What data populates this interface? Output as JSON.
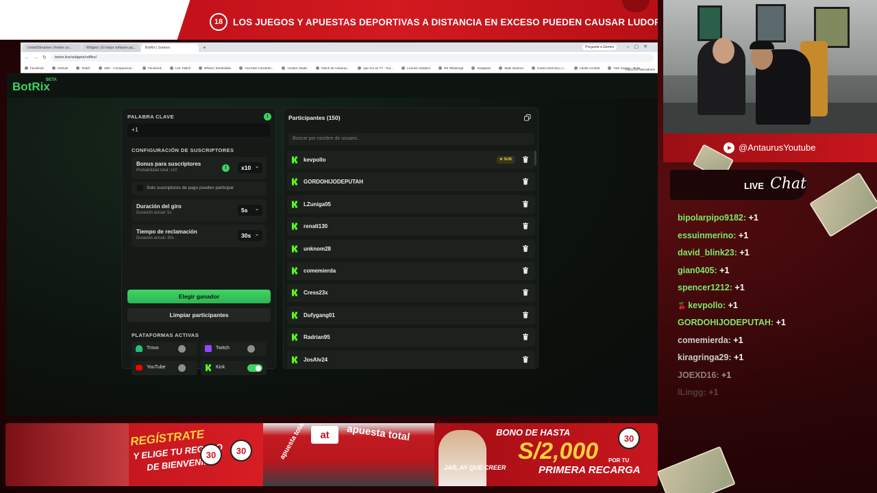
{
  "top_banner": {
    "age_badge": "18",
    "warning": "LOS JUEGOS Y APUESTAS DEPORTIVAS A DISTANCIA EN EXCESO PUEDEN CAUSAR LUDOPATÍA."
  },
  "browser": {
    "tabs": [
      "UnitedStreamer | Retenr yo...",
      "Widgets | El mejor software pa...",
      "BotRix | Sorteos"
    ],
    "new_tab": "+",
    "gemini": "Pregunta a Gemini",
    "url": "botrix.live/widgets/raffles/",
    "bookmarks": [
      "Facebook",
      "Hotmail",
      "Twitch",
      "UNC - Comparacion...",
      "Facebook",
      "LOL Twitch",
      "Wheel | Streamlabs",
      "YouTube Converter...",
      "Creator Studio",
      "Twitch de Antaurus...",
      "que rico es TT - You...",
      "License Violation",
      "DE WhatsApp",
      "Instagram",
      "Male Vazarna",
      "Casino Directory | t...",
      "Adobe Acrobat",
      "Twin Casino - Onlin..."
    ],
    "bookmarks_right": "Todos los marcadores"
  },
  "app": {
    "logo": "BotRix",
    "beta": "BETA",
    "keyword_label": "PALABRA CLAVE",
    "keyword_value": "+1",
    "subs_config_label": "CONFIGURACIÓN DE SUSCRIPTORES",
    "bonus_title": "Bonus para suscriptores",
    "bonus_sub": "Probabilidad total: x10",
    "bonus_value": "x10",
    "paid_only": "Solo suscriptores de pago pueden participar",
    "spin_title": "Duración del giro",
    "spin_sub": "Duración actual: 5s",
    "spin_value": "5s",
    "claim_title": "Tiempo de reclamación",
    "claim_sub": "Duración actual: 30s",
    "claim_value": "30s",
    "choose_winner": "Elegir ganador",
    "clear_participants": "Limpiar participantes",
    "platforms_label": "PLATAFORMAS ACTIVAS",
    "platforms": [
      {
        "name": "Trovo",
        "on": false,
        "color": "#1fc37a"
      },
      {
        "name": "Twitch",
        "on": false,
        "color": "#9146ff"
      },
      {
        "name": "YouTube",
        "on": false,
        "color": "#ff0000"
      },
      {
        "name": "Kick",
        "on": true,
        "color": "#53fc18"
      }
    ],
    "participants_title": "Participantes (150)",
    "search_placeholder": "Buscar por nombre de usuario...",
    "sub_badge": "SUB",
    "participants": [
      "kevpollo",
      "GORDOHIJODEPUTAH",
      "LZuniga05",
      "renalt130",
      "unknom28",
      "comemierda",
      "Cress23x",
      "Dufygang01",
      "Radrian95",
      "JosAlv24"
    ]
  },
  "stream": {
    "yt_handle": "@AntaurusYoutube",
    "live": "LIVE",
    "chat_word": "Chat",
    "messages": [
      {
        "user": "bipolarpipo9182:",
        "text": "+1"
      },
      {
        "user": "essuinmerino:",
        "text": "+1"
      },
      {
        "user": "david_blink23:",
        "text": "+1"
      },
      {
        "user": "gian0405:",
        "text": "+1"
      },
      {
        "user": "spencer1212:",
        "text": "+1"
      },
      {
        "user": "kevpollo:",
        "text": "+1"
      },
      {
        "user": "GORDOHIJODEPUTAH:",
        "text": "+1"
      },
      {
        "user": "comemierda:",
        "text": "+1"
      },
      {
        "user": "kiragringa29:",
        "text": "+1"
      },
      {
        "user": "JOEXD16:",
        "text": "+1"
      },
      {
        "user": "lLingg:",
        "text": "+1"
      }
    ]
  },
  "ad": {
    "register": "REGÍSTRATE",
    "register2": "Y ELIGE TU REGALO",
    "register3": "DE BIENVENIDA",
    "coin_a": "30",
    "coin_b": "30",
    "store_logo": "at",
    "store_sign": "apuesta total",
    "store_sign2": "apuesta total",
    "bono": "BONO DE HASTA",
    "amount": "S/2,000",
    "por": "POR TU",
    "primera": "PRIMERA RECARGA",
    "jar": "JAR, AY QUE CREER",
    "coin_c": "30"
  }
}
